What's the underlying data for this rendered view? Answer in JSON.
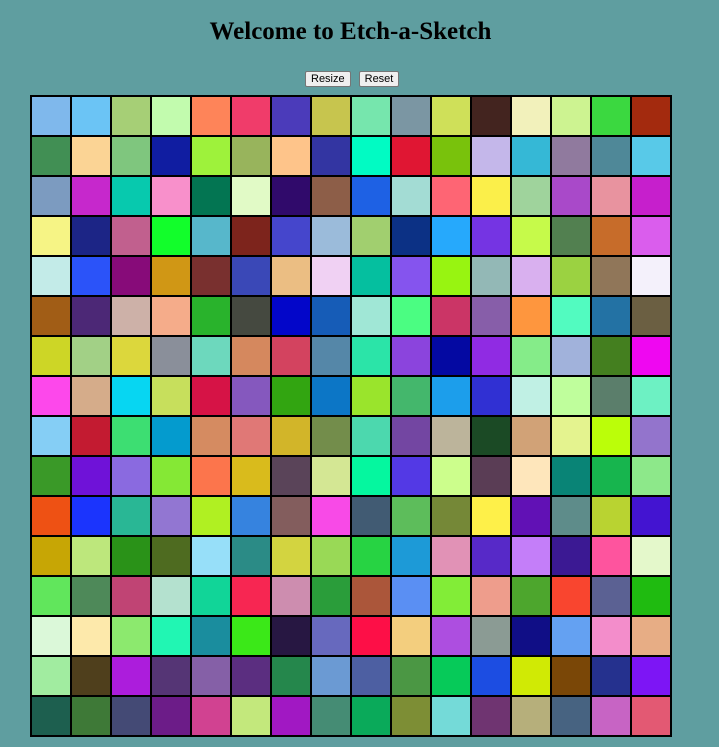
{
  "header": {
    "title": "Welcome to Etch-a-Sketch"
  },
  "controls": {
    "resize_label": "Resize",
    "reset_label": "Reset"
  },
  "grid": {
    "size": 16,
    "cells": [
      [
        "#7fb8ec",
        "#6bc4f5",
        "#a6cf76",
        "#c2fbae",
        "#fe8459",
        "#f03c6a",
        "#4b3bba",
        "#c7c54e",
        "#76e6ad",
        "#7b96a3",
        "#cfe059",
        "#43241f",
        "#f2f1bb",
        "#cdf391",
        "#3bd840",
        "#a32a0e"
      ],
      [
        "#418f54",
        "#fbd495",
        "#7fc67e",
        "#101da1",
        "#9ef23b",
        "#98b45c",
        "#fec48a",
        "#3335a2",
        "#01fbc3",
        "#e01633",
        "#79c20c",
        "#c4b7ea",
        "#35b8d6",
        "#907a9e",
        "#4f8898",
        "#58c9e8"
      ],
      [
        "#7c9bc0",
        "#c628cc",
        "#07c9ae",
        "#f890cb",
        "#037552",
        "#e1fac6",
        "#300a6b",
        "#8d5e48",
        "#1e61e4",
        "#a3dcd4",
        "#fe6574",
        "#fbef4a",
        "#9fd39c",
        "#a949c9",
        "#e8939f",
        "#c61fcc"
      ],
      [
        "#f6f485",
        "#1c2586",
        "#c1608e",
        "#12fe2b",
        "#57b7cb",
        "#7d241c",
        "#4546cc",
        "#9bbbda",
        "#a1cf6f",
        "#0c3185",
        "#26a9fc",
        "#7534e3",
        "#c6fa4a",
        "#528050",
        "#c76c2a",
        "#da5ded"
      ],
      [
        "#c3ebe8",
        "#2b53f9",
        "#870b79",
        "#d09715",
        "#79302f",
        "#3a48b7",
        "#ebbe83",
        "#f0d1f3",
        "#05bf9f",
        "#8554ee",
        "#98f411",
        "#93b8b6",
        "#d9b0ef",
        "#9bd241",
        "#907659",
        "#f4f1fb"
      ],
      [
        "#a15d16",
        "#4c2876",
        "#cdb1a8",
        "#f5ac8a",
        "#29b32c",
        "#454940",
        "#0306c9",
        "#165cb7",
        "#a0e7d6",
        "#4bfd82",
        "#cb3566",
        "#875ea9",
        "#fe963e",
        "#52fbc0",
        "#2372a4",
        "#6b5f42"
      ],
      [
        "#cdd626",
        "#a2d086",
        "#dcd73c",
        "#8a8f9a",
        "#6dd8bd",
        "#d5885e",
        "#d3435f",
        "#5587a8",
        "#2be4a8",
        "#8b44dd",
        "#0409a2",
        "#902be3",
        "#85ec89",
        "#a1b2db",
        "#447f1f",
        "#ef07f1"
      ],
      [
        "#fd48eb",
        "#d5ac8a",
        "#07d6f2",
        "#c7df5c",
        "#d61346",
        "#8558be",
        "#32a511",
        "#0c76c6",
        "#9ae42c",
        "#44b76c",
        "#1c9eeb",
        "#3030d3",
        "#c0f0e4",
        "#bffe9c",
        "#5b7e6b",
        "#6df1c3"
      ],
      [
        "#85cef5",
        "#c31b31",
        "#3dde72",
        "#049bce",
        "#d58b61",
        "#e07876",
        "#d2b529",
        "#738d4b",
        "#4cd8ae",
        "#7346a2",
        "#bcb49b",
        "#1b4a25",
        "#d1a277",
        "#e4f38f",
        "#bbfe09",
        "#9374cc"
      ],
      [
        "#3a9928",
        "#6f12d8",
        "#8a6ae0",
        "#85e835",
        "#fc754c",
        "#d9bb1c",
        "#5a4459",
        "#d4e794",
        "#05f79f",
        "#5339e5",
        "#ccfe8c",
        "#5a3d55",
        "#fee6bb",
        "#098476",
        "#17b54e",
        "#8de88a"
      ],
      [
        "#ee5114",
        "#1b34fd",
        "#29b795",
        "#9276d2",
        "#b0f022",
        "#3683df",
        "#835d5d",
        "#f84ae7",
        "#415b73",
        "#5dbd5b",
        "#758837",
        "#fef049",
        "#6111b5",
        "#5e8c8a",
        "#b9d331",
        "#4314d1"
      ],
      [
        "#c7a605",
        "#bde77c",
        "#2a9218",
        "#4e6b20",
        "#97dff9",
        "#2b8b86",
        "#d3d440",
        "#99d956",
        "#27d343",
        "#1d9ad7",
        "#e192b6",
        "#5729c8",
        "#c47ef9",
        "#3b1993",
        "#fe549e",
        "#e4f8cb"
      ],
      [
        "#61e65c",
        "#4e8959",
        "#c04474",
        "#b4e1cf",
        "#11d598",
        "#f72652",
        "#cd8daf",
        "#2a9d3a",
        "#ab563a",
        "#5a8ff3",
        "#82ed37",
        "#ee9d8c",
        "#4da62d",
        "#f9452f",
        "#5b6193",
        "#1fbb10"
      ],
      [
        "#dbf8d9",
        "#fde9ab",
        "#8ce96e",
        "#21f6b3",
        "#1a8d9e",
        "#3be818",
        "#271742",
        "#6769be",
        "#fd0f47",
        "#f3ce7e",
        "#ad4ee0",
        "#8b9b94",
        "#100e86",
        "#64a1f2",
        "#f38dcb",
        "#e7ad85"
      ],
      [
        "#a1eca0",
        "#4f3f1c",
        "#ac1ddc",
        "#553575",
        "#8560a7",
        "#5b2e80",
        "#25874c",
        "#6b9ad3",
        "#4d5fa2",
        "#4b9744",
        "#06ca59",
        "#1c4de2",
        "#d0ea05",
        "#7a4707",
        "#25318e",
        "#7d15f5"
      ],
      [
        "#1d5f4f",
        "#3e7937",
        "#444a75",
        "#6c1c88",
        "#d14291",
        "#c3e87c",
        "#a118c3",
        "#458c74",
        "#0aaa5a",
        "#7d8e35",
        "#74dad8",
        "#6f3471",
        "#b6af7b",
        "#476381",
        "#c764c4",
        "#e35973"
      ]
    ]
  }
}
